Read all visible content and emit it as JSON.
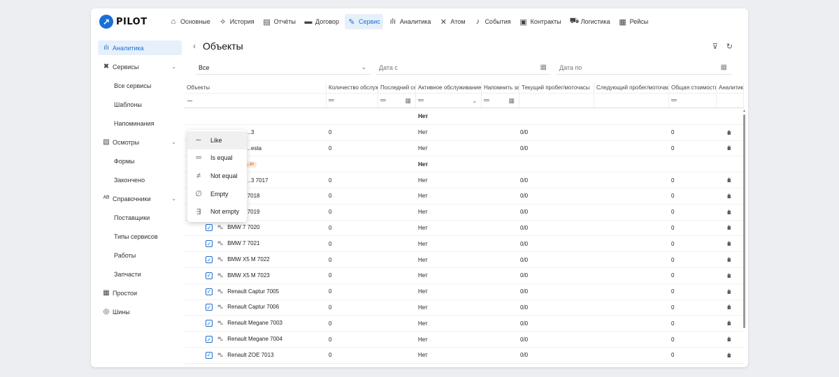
{
  "logo": {
    "text": "PILOT"
  },
  "nav": [
    {
      "label": "Основные",
      "icon": "home-icon",
      "glyph": "⌂",
      "active": false
    },
    {
      "label": "История",
      "icon": "route-icon",
      "glyph": "⟡",
      "active": false
    },
    {
      "label": "Отчёты",
      "icon": "report-icon",
      "glyph": "▤",
      "active": false
    },
    {
      "label": "Договор",
      "icon": "contract-icon",
      "glyph": "▬",
      "active": false
    },
    {
      "label": "Сервис",
      "icon": "wrench-icon",
      "glyph": "✎",
      "active": true
    },
    {
      "label": "Аналитика",
      "icon": "analytics-icon",
      "glyph": "ılı",
      "active": false
    },
    {
      "label": "Атом",
      "icon": "atom-icon",
      "glyph": "✕",
      "active": false
    },
    {
      "label": "События",
      "icon": "bell-icon",
      "glyph": "♪",
      "active": false
    },
    {
      "label": "Контракты",
      "icon": "briefcase-icon",
      "glyph": "▣",
      "active": false
    },
    {
      "label": "Логистика",
      "icon": "truck-icon",
      "glyph": "⛟",
      "active": false
    },
    {
      "label": "Рейсы",
      "icon": "bus-icon",
      "glyph": "▦",
      "active": false
    }
  ],
  "sidebar": [
    {
      "label": "Аналитика",
      "icon": "analytics-icon",
      "glyph": "ılı",
      "active": true,
      "sub": false,
      "chevron": false
    },
    {
      "label": "Сервисы",
      "icon": "tools-icon",
      "glyph": "✖",
      "active": false,
      "sub": false,
      "chevron": true
    },
    {
      "label": "Все сервисы",
      "sub": true
    },
    {
      "label": "Шаблоны",
      "sub": true
    },
    {
      "label": "Напоминания",
      "sub": true
    },
    {
      "label": "Осмотры",
      "icon": "clipboard-icon",
      "glyph": "▧",
      "active": false,
      "sub": false,
      "chevron": true
    },
    {
      "label": "Формы",
      "sub": true
    },
    {
      "label": "Закончено",
      "sub": true
    },
    {
      "label": "Справочники",
      "icon": "dictionary-icon",
      "glyph": "ᴬᴮ",
      "active": false,
      "sub": false,
      "chevron": true
    },
    {
      "label": "Поставщики",
      "sub": true
    },
    {
      "label": "Типы сервисов",
      "sub": true
    },
    {
      "label": "Работы",
      "sub": true
    },
    {
      "label": "Запчасти",
      "sub": true
    },
    {
      "label": "Простои",
      "icon": "bus-icon",
      "glyph": "▦",
      "active": false,
      "sub": false,
      "chevron": false
    },
    {
      "label": "Шины",
      "icon": "tire-icon",
      "glyph": "◎",
      "active": false,
      "sub": false,
      "chevron": false
    }
  ],
  "page": {
    "back": "‹",
    "title": "Объекты"
  },
  "filters": {
    "select_value": "Все",
    "date_from_placeholder": "Дата с",
    "date_to_placeholder": "Дата по"
  },
  "columns": [
    "Объекты",
    "Количество обслуживаний",
    "Последний сервис",
    "Активное обслуживание",
    "Напомнить за",
    "Текущий пробег/моточасы",
    "Следующий пробег/моточасы",
    "Общая стоимость",
    "Аналитика"
  ],
  "filter_menu": [
    {
      "symbol": "∼",
      "label": "Like",
      "icon": "like-icon"
    },
    {
      "symbol": "═",
      "label": "Is equal",
      "icon": "equal-icon"
    },
    {
      "symbol": "≠",
      "label": "Not equal",
      "icon": "not-equal-icon"
    },
    {
      "symbol": "∅",
      "label": "Empty",
      "icon": "empty-icon"
    },
    {
      "symbol": "∃",
      "label": "Not empty",
      "icon": "not-empty-icon"
    }
  ],
  "rows": [
    {
      "group": true,
      "name": "",
      "count": "",
      "active": "Нет",
      "mileage": "",
      "cost": ""
    },
    {
      "group": false,
      "name": "…3",
      "count": "0",
      "active": "Нет",
      "mileage": "0/0",
      "cost": "0"
    },
    {
      "group": false,
      "name": "…esta",
      "count": "0",
      "active": "Нет",
      "mileage": "0/0",
      "cost": "0"
    },
    {
      "group": true,
      "name": "",
      "badge": "…er",
      "count": "",
      "active": "Нет",
      "mileage": "",
      "cost": ""
    },
    {
      "group": false,
      "name": "…3 7017",
      "count": "0",
      "active": "Нет",
      "mileage": "0/0",
      "cost": "0"
    },
    {
      "group": false,
      "name": "BMW 3 7018",
      "count": "0",
      "active": "Нет",
      "mileage": "0/0",
      "cost": "0"
    },
    {
      "group": false,
      "name": "BMW 3 7019",
      "count": "0",
      "active": "Нет",
      "mileage": "0/0",
      "cost": "0"
    },
    {
      "group": false,
      "name": "BMW 7 7020",
      "count": "0",
      "active": "Нет",
      "mileage": "0/0",
      "cost": "0"
    },
    {
      "group": false,
      "name": "BMW 7 7021",
      "count": "0",
      "active": "Нет",
      "mileage": "0/0",
      "cost": "0"
    },
    {
      "group": false,
      "name": "BMW X5 M 7022",
      "count": "0",
      "active": "Нет",
      "mileage": "0/0",
      "cost": "0"
    },
    {
      "group": false,
      "name": "BMW X5 M 7023",
      "count": "0",
      "active": "Нет",
      "mileage": "0/0",
      "cost": "0"
    },
    {
      "group": false,
      "name": "Renault Captur 7005",
      "count": "0",
      "active": "Нет",
      "mileage": "0/0",
      "cost": "0"
    },
    {
      "group": false,
      "name": "Renault Captur 7006",
      "count": "0",
      "active": "Нет",
      "mileage": "0/0",
      "cost": "0"
    },
    {
      "group": false,
      "name": "Renault Megane 7003",
      "count": "0",
      "active": "Нет",
      "mileage": "0/0",
      "cost": "0"
    },
    {
      "group": false,
      "name": "Renault Megane 7004",
      "count": "0",
      "active": "Нет",
      "mileage": "0/0",
      "cost": "0"
    },
    {
      "group": false,
      "name": "Renault ZOE 7013",
      "count": "0",
      "active": "Нет",
      "mileage": "0/0",
      "cost": "0"
    }
  ]
}
